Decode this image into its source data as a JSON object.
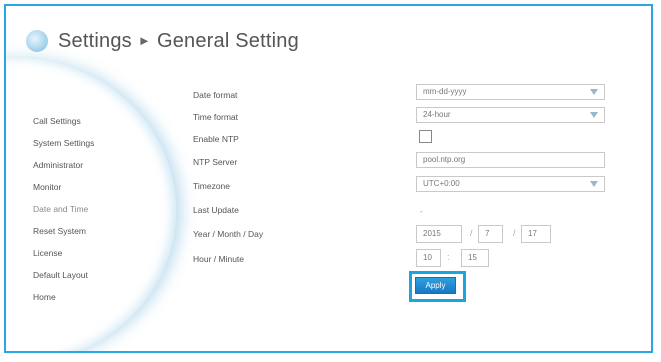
{
  "header": {
    "section": "Settings",
    "arrow": "►",
    "page": "General Setting"
  },
  "sidebar": {
    "items": [
      {
        "label": "Call Settings"
      },
      {
        "label": "System Settings"
      },
      {
        "label": "Administrator"
      },
      {
        "label": "Monitor"
      },
      {
        "label": "Date and Time"
      },
      {
        "label": "Reset System"
      },
      {
        "label": "License"
      },
      {
        "label": "Default Layout"
      },
      {
        "label": "Home"
      }
    ]
  },
  "form": {
    "date_format": {
      "label": "Date format",
      "value": "mm-dd-yyyy"
    },
    "time_format": {
      "label": "Time format",
      "value": "24-hour"
    },
    "enable_ntp": {
      "label": "Enable NTP",
      "checked": false
    },
    "ntp_server": {
      "label": "NTP Server",
      "value": "pool.ntp.org"
    },
    "timezone": {
      "label": "Timezone",
      "value": "UTC+0:00"
    },
    "last_update": {
      "label": "Last Update",
      "value": "-"
    },
    "ymd": {
      "label": "Year / Month / Day",
      "year": "2015",
      "month": "7",
      "day": "17",
      "sep": "/"
    },
    "hm": {
      "label": "Hour / Minute",
      "hour": "10",
      "minute": "15",
      "sep": ":"
    }
  },
  "apply_label": "Apply",
  "colors": {
    "accent": "#1aa3dd",
    "border": "#2aa6e0"
  }
}
